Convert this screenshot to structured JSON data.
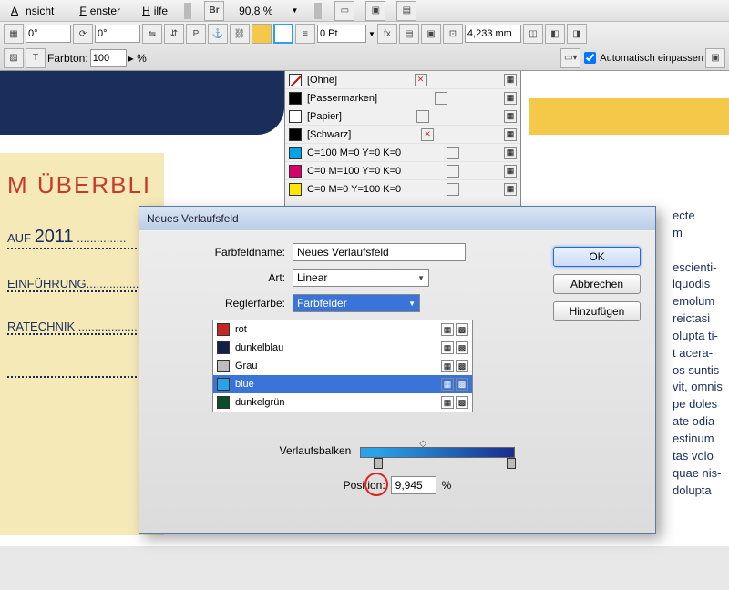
{
  "menu": {
    "ansicht": "Ansicht",
    "fenster": "Fenster",
    "hilfe": "Hilfe",
    "br": "Br",
    "zoom": "90,8 %"
  },
  "toolbar": {
    "angle": "0°",
    "pt_field": "0 Pt",
    "measure": "4,233 mm",
    "auto_fit": "Automatisch einpassen",
    "farbton_label": "Farbton:",
    "farbton_val": "100",
    "farbton_unit": "%"
  },
  "doc": {
    "heading": "M ÜBERBLI",
    "toc1_pre": " AUF ",
    "toc1_year": "2011",
    "toc1_dots": " ...............",
    "toc2": "EINFÜHRUNG.............................",
    "toc3": "RATECHNIK  .............................",
    "rtext": "ecte\nm\n\nescienti-\nlquodis\nemolum\n reictasi\nolupta ti-\nt acera-\nos suntis\nvit, omnis\npe doles\nate odia\nestinum\ntas volo\nquae nis-\ndolupta\n"
  },
  "swatches": {
    "items": [
      {
        "name": "[Ohne]",
        "color": "none",
        "no_x": true
      },
      {
        "name": "[Passermarken]",
        "color": "#000"
      },
      {
        "name": "[Papier]",
        "color": "#fff"
      },
      {
        "name": "[Schwarz]",
        "color": "#000",
        "no_x": true
      },
      {
        "name": "C=100 M=0 Y=0 K=0",
        "color": "#00a3e6"
      },
      {
        "name": "C=0 M=100 Y=0 K=0",
        "color": "#d6006c"
      },
      {
        "name": "C=0 M=0 Y=100 K=0",
        "color": "#ffe500"
      }
    ]
  },
  "dialog": {
    "title": "Neues Verlaufsfeld",
    "name_label": "Farbfeldname:",
    "name_val": "Neues Verlaufsfeld",
    "art_label": "Art:",
    "art_val": "Linear",
    "regler_label": "Reglerfarbe:",
    "regler_val": "Farbfelder",
    "colors": [
      {
        "name": "rot",
        "c": "#c62828"
      },
      {
        "name": "dunkelblau",
        "c": "#13204a"
      },
      {
        "name": "Grau",
        "c": "#bdbdbd"
      },
      {
        "name": "blue",
        "c": "#2aa3e6",
        "sel": true
      },
      {
        "name": "dunkelgrün",
        "c": "#0b4d2a"
      }
    ],
    "grad_label": "Verlaufsbalken",
    "pos_label": "Position:",
    "pos_val": "9,945",
    "pos_unit": "%",
    "ok": "OK",
    "cancel": "Abbrechen",
    "add": "Hinzufügen"
  }
}
